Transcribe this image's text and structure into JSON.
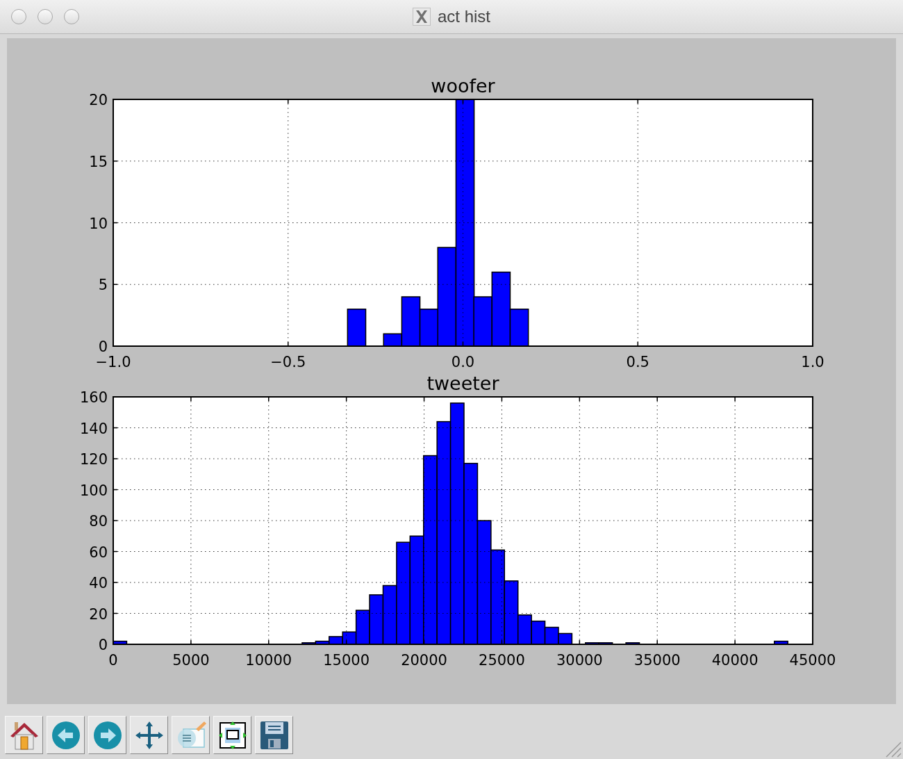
{
  "window": {
    "title": "act hist"
  },
  "figure": {
    "axes": [
      {
        "chart_data": {
          "type": "bar",
          "title": "woofer",
          "x": [
            -0.304,
            -0.252,
            -0.201,
            -0.149,
            -0.097,
            -0.046,
            0.006,
            0.057,
            0.109,
            0.161
          ],
          "values": [
            3,
            0,
            1,
            4,
            3,
            8,
            20,
            4,
            6,
            3
          ],
          "xlim": [
            -1,
            1
          ],
          "ylim": [
            0,
            20
          ],
          "xticks": [
            {
              "value": -1,
              "label": "−1.0"
            },
            {
              "value": -0.5,
              "label": "−0.5"
            },
            {
              "value": 0,
              "label": "0.0"
            },
            {
              "value": 0.5,
              "label": "0.5"
            },
            {
              "value": 1,
              "label": "1.0"
            }
          ],
          "yticks": [
            0,
            5,
            10,
            15,
            20
          ],
          "grid": true
        }
      },
      {
        "chart_data": {
          "type": "bar",
          "title": "tweeter",
          "x": [
            434,
            1302,
            2170,
            3038,
            3906,
            4774,
            5642,
            6510,
            7378,
            8246,
            9114,
            9982,
            10850,
            11718,
            12586,
            13454,
            14322,
            15190,
            16058,
            16926,
            17794,
            18662,
            19530,
            20398,
            21266,
            22134,
            23002,
            23870,
            24738,
            25606,
            26474,
            27342,
            28210,
            29078,
            29946,
            30814,
            31682,
            32550,
            33418,
            34286,
            35154,
            36022,
            36890,
            37758,
            38626,
            39494,
            40362,
            41230,
            42098,
            42966
          ],
          "values": [
            2,
            0,
            0,
            0,
            0,
            0,
            0,
            0,
            0,
            0,
            0,
            0,
            0,
            0,
            1,
            2,
            5,
            8,
            22,
            32,
            38,
            66,
            70,
            122,
            144,
            156,
            117,
            80,
            61,
            41,
            19,
            15,
            11,
            7,
            0,
            1,
            1,
            0,
            1,
            0,
            0,
            0,
            0,
            0,
            0,
            0,
            0,
            0,
            0,
            2
          ],
          "xlim": [
            0,
            45000
          ],
          "ylim": [
            0,
            160
          ],
          "xticks": [
            0,
            5000,
            10000,
            15000,
            20000,
            25000,
            30000,
            35000,
            40000,
            45000
          ],
          "yticks": [
            0,
            20,
            40,
            60,
            80,
            100,
            120,
            140,
            160
          ],
          "grid": true
        }
      }
    ]
  },
  "toolbar": {
    "buttons": [
      {
        "kind": "home"
      },
      {
        "kind": "back"
      },
      {
        "kind": "forward"
      },
      {
        "kind": "pan"
      },
      {
        "kind": "zoom"
      },
      {
        "kind": "subplots"
      },
      {
        "kind": "save"
      }
    ]
  }
}
